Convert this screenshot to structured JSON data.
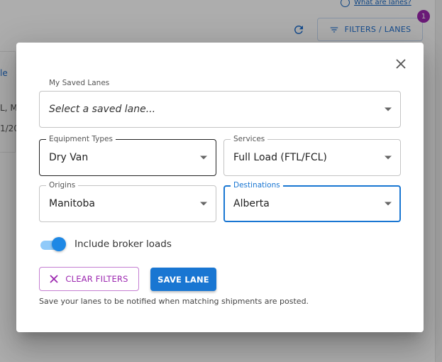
{
  "background": {
    "help_link": "What are lanes?",
    "filters_button": "FILTERS / LANES",
    "filter_count": "1",
    "fragments": [
      "le",
      "L, M",
      "1/20"
    ]
  },
  "modal": {
    "saved_lanes": {
      "label": "My Saved Lanes",
      "placeholder": "Select a saved lane..."
    },
    "equipment": {
      "label": "Equipment Types",
      "value": "Dry Van"
    },
    "services": {
      "label": "Services",
      "value": "Full Load (FTL/FCL)"
    },
    "origins": {
      "label": "Origins",
      "value": "Manitoba"
    },
    "destinations": {
      "label": "Destinations",
      "value": "Alberta"
    },
    "broker_toggle": {
      "label": "Include broker loads",
      "on": true
    },
    "clear_button": "CLEAR FILTERS",
    "save_button": "SAVE LANE",
    "hint": "Save your lanes to be notified when matching shipments are posted."
  },
  "colors": {
    "primary": "#1976d2",
    "secondary": "#9c27b0",
    "toggle_track": "#90caf9"
  },
  "icons": {
    "close": "close-icon",
    "clear": "close-icon",
    "dropdown": "caret-down-icon",
    "filters": "filter-icon",
    "refresh": "refresh-icon",
    "help": "help-circle-icon"
  }
}
